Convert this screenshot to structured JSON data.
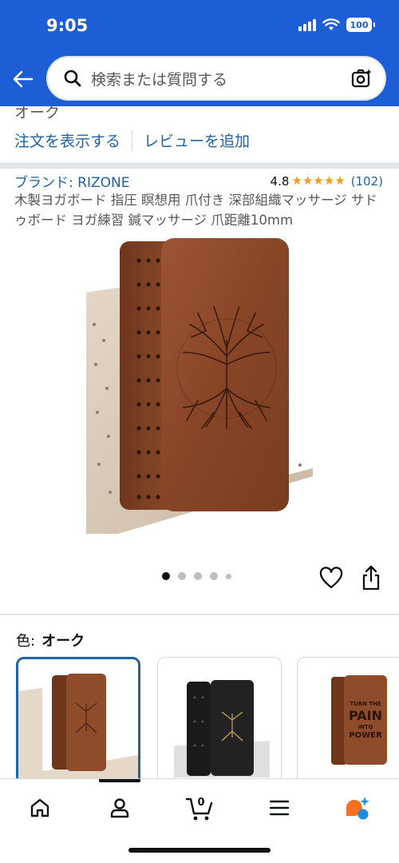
{
  "status_bar": {
    "time": "9:05",
    "battery": "100"
  },
  "header": {
    "back_icon": "arrow-left-icon",
    "search_placeholder": "検索または質問する",
    "camera_icon": "camera-sparkle-icon"
  },
  "previous_section": {
    "partial_text": "オーク"
  },
  "order_links": {
    "view_order": "注文を表示する",
    "add_review": "レビューを追加"
  },
  "product": {
    "brand": "ブランド: RIZONE",
    "rating": "4.8",
    "stars": 4.8,
    "review_count": "(102)",
    "title": "木製ヨガボード 指圧 瞑想用 爪付き 深部組織マッサージ サドゥボード ヨガ練習 鍼マッサージ 爪距離10mm",
    "image_count": 5,
    "active_image_index": 0
  },
  "variation": {
    "label": "色:",
    "selected_value": "オーク",
    "swatches": [
      {
        "name": "oak",
        "selected": true
      },
      {
        "name": "black",
        "selected": false
      },
      {
        "name": "turn-the-pain",
        "selected": false,
        "text_lines": [
          "TURN THE",
          "PAIN",
          "INTO",
          "POWER"
        ]
      }
    ]
  },
  "bottom_nav": {
    "items": [
      "home-icon",
      "account-icon",
      "cart-icon",
      "menu-icon",
      "rufus-icon"
    ],
    "cart_count": "0",
    "active_index": 1
  },
  "colors": {
    "header_blue": "#1d5dd6",
    "link_blue": "#2162a1",
    "star_orange": "#f79b1c",
    "wood_brown": "#8b4a2b"
  }
}
